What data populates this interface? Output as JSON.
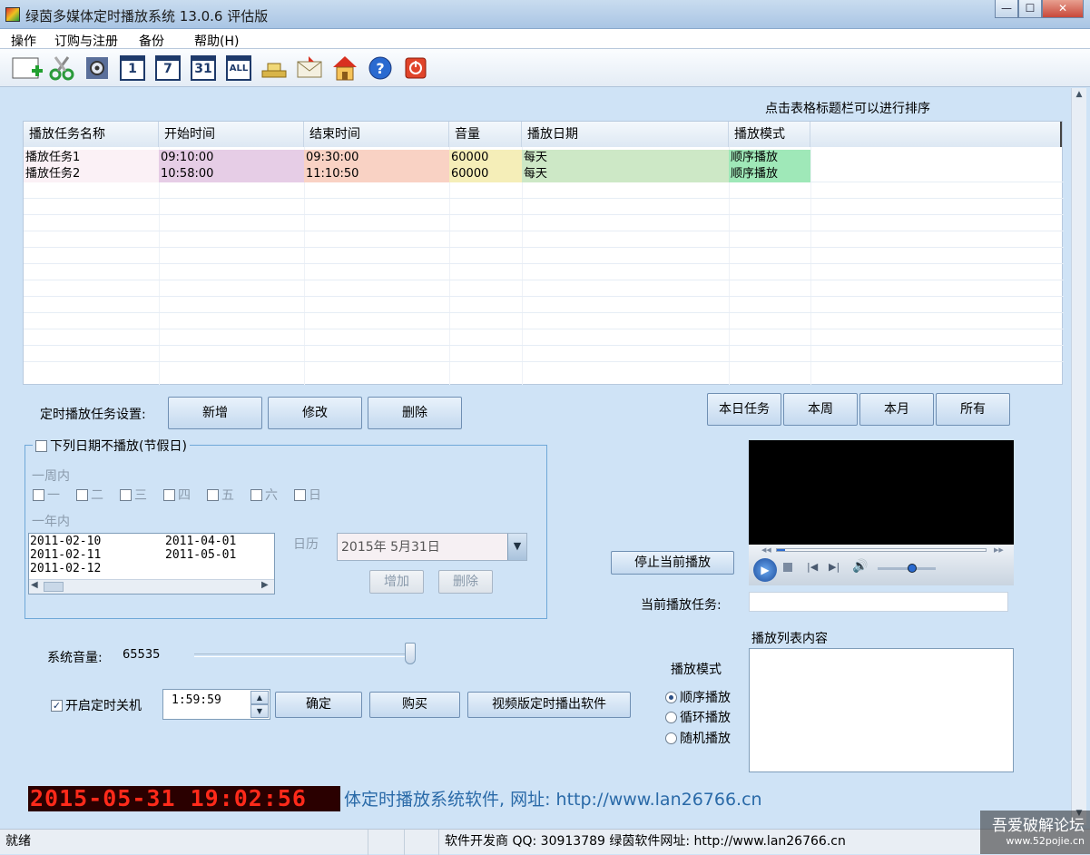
{
  "window": {
    "title": "绿茵多媒体定时播放系统 13.0.6 评估版",
    "minimize": "—",
    "maximize": "☐",
    "close": "✕"
  },
  "menu": [
    "操作",
    "订购与注册",
    "备份",
    "帮助(H)"
  ],
  "toolbar": {
    "icons": [
      "add-task-icon",
      "scissors-icon",
      "settings-gear-icon",
      "calendar-day-icon",
      "calendar-week-icon",
      "calendar-month-icon",
      "calendar-all-icon",
      "scale-icon",
      "envelope-icon",
      "home-icon",
      "help-icon",
      "power-icon"
    ],
    "cal_day": "1",
    "cal_week": "7",
    "cal_month": "31",
    "cal_all": "ALL"
  },
  "sort_hint": "点击表格标题栏可以进行排序",
  "table": {
    "headers": [
      "播放任务名称",
      "开始时间",
      "结束时间",
      "音量",
      "播放日期",
      "播放模式"
    ],
    "rows": [
      {
        "name": "播放任务1",
        "start": "09:10:00",
        "end": "09:30:00",
        "volume": "60000",
        "date": "每天",
        "mode": "顺序播放"
      },
      {
        "name": "播放任务2",
        "start": "10:58:00",
        "end": "11:10:50",
        "volume": "60000",
        "date": "每天",
        "mode": "顺序播放"
      }
    ]
  },
  "task_settings": {
    "label": "定时播放任务设置:",
    "new": "新增",
    "edit": "修改",
    "delete": "删除"
  },
  "filters": {
    "today": "本日任务",
    "week": "本周",
    "month": "本月",
    "all": "所有"
  },
  "holidays": {
    "title": "下列日期不播放(节假日)",
    "week_label": "一周内",
    "days": [
      "一",
      "二",
      "三",
      "四",
      "五",
      "六",
      "日"
    ],
    "year_label": "一年内",
    "dates_col1": [
      "2011-02-10",
      "2011-02-11",
      "2011-02-12"
    ],
    "dates_col2": [
      "2011-04-01",
      "2011-05-01"
    ],
    "calendar_label": "日历",
    "calendar_value": "2015年  5月31日",
    "add": "增加",
    "remove": "删除"
  },
  "player": {
    "stop": "停止当前播放",
    "current_label": "当前播放任务:",
    "current_value": "",
    "progress": 0.04,
    "volume": 0.6
  },
  "playlist": {
    "label": "播放列表内容"
  },
  "mode": {
    "label": "播放模式",
    "options": [
      "顺序播放",
      "循环播放",
      "随机播放"
    ],
    "selected": "顺序播放"
  },
  "system": {
    "volume_label": "系统音量:",
    "volume_value": "65535",
    "volume_level": 1.0,
    "shutdown_label": "开启定时关机",
    "shutdown_checked": true,
    "shutdown_time": "1:59:59",
    "confirm": "确定",
    "buy": "购买",
    "video_version": "视频版定时播出软件"
  },
  "clock": "2015-05-31 19:02:56",
  "marquee": "体定时播放系统软件, 网址: http://www.lan26766.cn",
  "status": {
    "ready": "就绪",
    "qq": "软件开发商 QQ:  30913789   绿茵软件网址:  http://www.lan26766.cn"
  },
  "watermark": {
    "line1": "吾爱破解论坛",
    "line2": "www.52pojie.cn"
  },
  "colors": {
    "accent": "#2a6aa8",
    "clock": "#ff2a1a",
    "row_start": "#e6cde6",
    "row_end": "#f9d2c4",
    "row_volume": "#f5eeb8",
    "row_date": "#cde8c6",
    "row_mode": "#9fe8b8"
  }
}
